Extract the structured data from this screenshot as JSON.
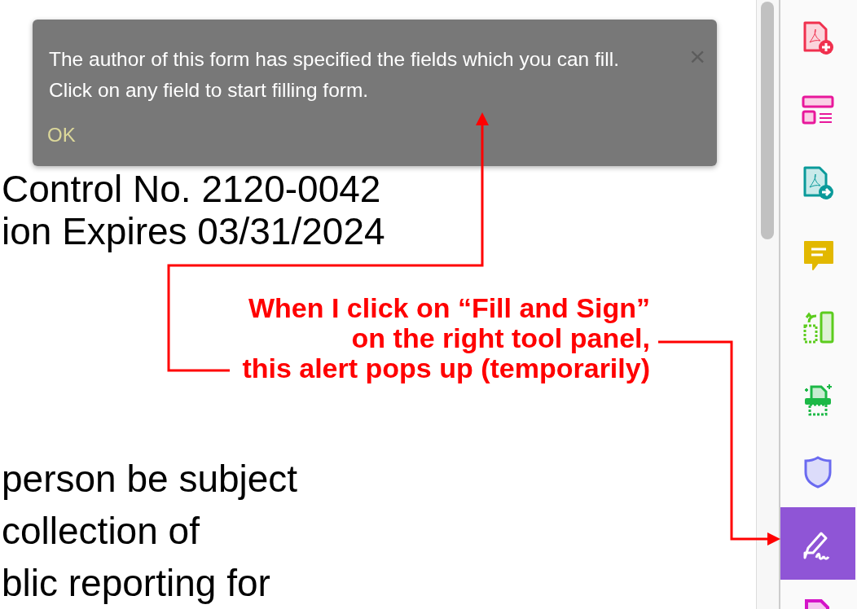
{
  "document": {
    "lines_top": [
      "Control No. 2120-0042",
      "ion Expires 03/31/2024"
    ],
    "lines_bottom": [
      "person be subject",
      "collection of",
      "blic reporting for"
    ]
  },
  "alert": {
    "message": "The author of this form has specified the fields which you can fill. Click on any field to start filling form.",
    "close": "×",
    "ok": "OK"
  },
  "annotation": {
    "text": "When I click on “Fill and Sign”\non the right tool panel,\nthis alert pops up (temporarily)"
  },
  "tools": [
    {
      "kind": "create",
      "selected": false
    },
    {
      "kind": "organize",
      "selected": false
    },
    {
      "kind": "export",
      "selected": false
    },
    {
      "kind": "comment",
      "selected": false
    },
    {
      "kind": "compress",
      "selected": false
    },
    {
      "kind": "print",
      "selected": false
    },
    {
      "kind": "protect",
      "selected": false
    },
    {
      "kind": "sign",
      "selected": true
    },
    {
      "kind": "more",
      "selected": false
    }
  ]
}
